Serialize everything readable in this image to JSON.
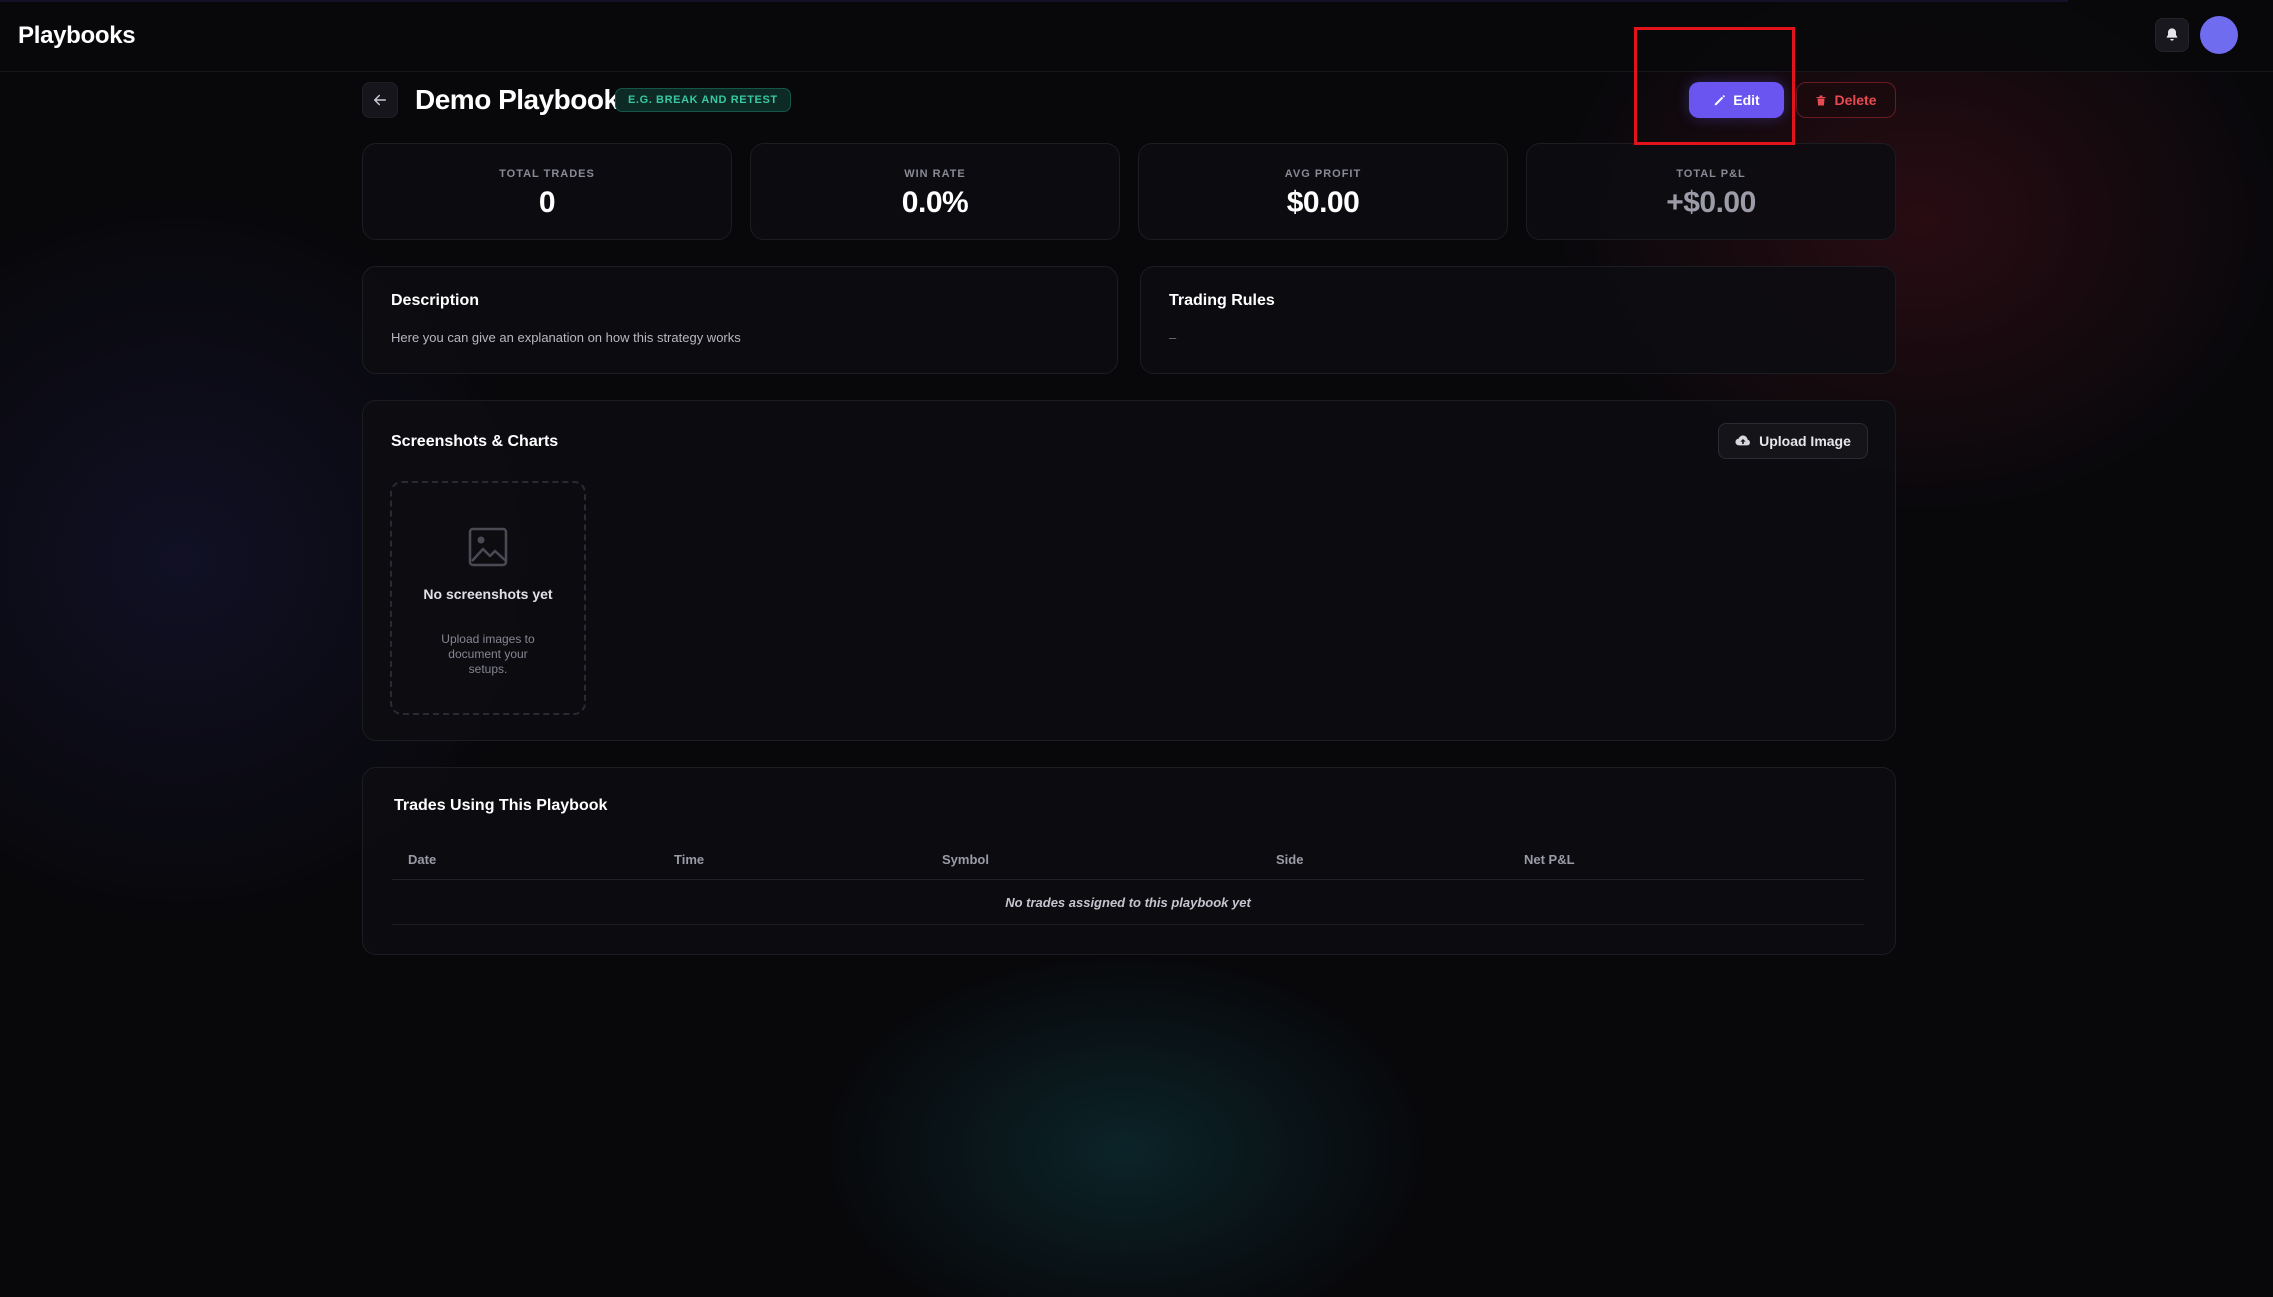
{
  "app": {
    "title": "Playbooks"
  },
  "header": {
    "notifications_icon": "bell-icon",
    "avatar_color": "#6f6cf0"
  },
  "playbook": {
    "title": "Demo Playbook",
    "tag": "E.G. BREAK AND RETEST",
    "edit_label": "Edit",
    "delete_label": "Delete"
  },
  "stats": [
    {
      "label": "TOTAL TRADES",
      "value": "0"
    },
    {
      "label": "WIN RATE",
      "value": "0.0%"
    },
    {
      "label": "AVG PROFIT",
      "value": "$0.00"
    },
    {
      "label": "TOTAL P&L",
      "value": "+$0.00"
    }
  ],
  "description": {
    "title": "Description",
    "text": "Here you can give an explanation on how this strategy works"
  },
  "rules": {
    "title": "Trading Rules",
    "text": "–"
  },
  "screenshots": {
    "title": "Screenshots & Charts",
    "upload_label": "Upload Image",
    "empty_title": "No screenshots yet",
    "empty_sub": "Upload images to document your setups."
  },
  "trades": {
    "title": "Trades Using This Playbook",
    "columns": [
      "Date",
      "Time",
      "Symbol",
      "Side",
      "Net P&L"
    ],
    "empty": "No trades assigned to this playbook yet"
  },
  "colors": {
    "accent": "#6b55f0",
    "danger": "#e84a52",
    "tag": "#38c9a2",
    "highlight": "#e3131b"
  }
}
